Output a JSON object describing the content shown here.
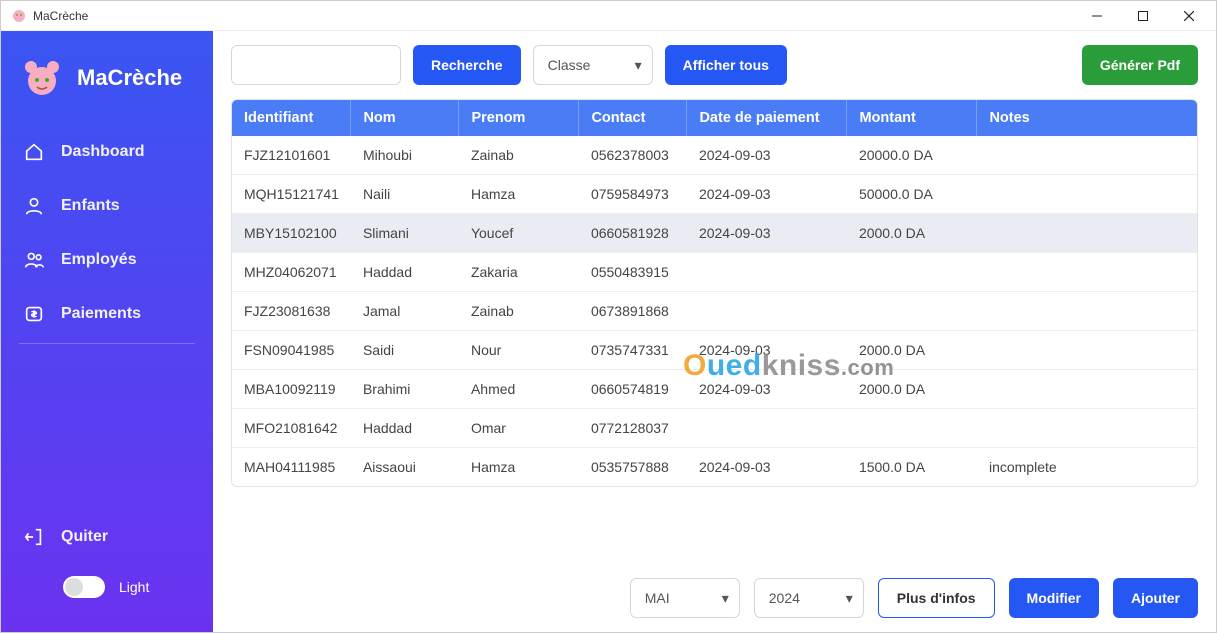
{
  "window": {
    "title": "MaCrèche"
  },
  "brand": {
    "name": "MaCrèche"
  },
  "sidebar": {
    "items": [
      {
        "label": "Dashboard"
      },
      {
        "label": "Enfants"
      },
      {
        "label": "Employés"
      },
      {
        "label": "Paiements"
      }
    ],
    "quit": "Quiter",
    "theme_label": "Light"
  },
  "toolbar": {
    "search_value": "",
    "search_label": "Recherche",
    "filter_selected": "Classe",
    "show_all_label": "Afficher tous",
    "pdf_label": "Générer Pdf"
  },
  "table": {
    "headers": {
      "id": "Identifiant",
      "nom": "Nom",
      "prenom": "Prenom",
      "contact": "Contact",
      "date": "Date de paiement",
      "montant": "Montant",
      "notes": "Notes"
    },
    "rows": [
      {
        "id": "FJZ12101601",
        "nom": "Mihoubi",
        "prenom": "Zainab",
        "contact": "0562378003",
        "date": "2024-09-03",
        "montant": "20000.0 DA",
        "notes": "",
        "selected": false
      },
      {
        "id": "MQH15121741",
        "nom": "Naili",
        "prenom": "Hamza",
        "contact": "0759584973",
        "date": "2024-09-03",
        "montant": "50000.0 DA",
        "notes": "",
        "selected": false
      },
      {
        "id": "MBY15102100",
        "nom": "Slimani",
        "prenom": "Youcef",
        "contact": "0660581928",
        "date": "2024-09-03",
        "montant": "2000.0 DA",
        "notes": "",
        "selected": true
      },
      {
        "id": "MHZ04062071",
        "nom": "Haddad",
        "prenom": "Zakaria",
        "contact": "0550483915",
        "date": "",
        "montant": "",
        "notes": "",
        "selected": false
      },
      {
        "id": "FJZ23081638",
        "nom": "Jamal",
        "prenom": "Zainab",
        "contact": "0673891868",
        "date": "",
        "montant": "",
        "notes": "",
        "selected": false
      },
      {
        "id": "FSN09041985",
        "nom": "Saidi",
        "prenom": "Nour",
        "contact": "0735747331",
        "date": "2024-09-03",
        "montant": "2000.0 DA",
        "notes": "",
        "selected": false
      },
      {
        "id": "MBA10092119",
        "nom": "Brahimi",
        "prenom": "Ahmed",
        "contact": "0660574819",
        "date": "2024-09-03",
        "montant": "2000.0 DA",
        "notes": "",
        "selected": false
      },
      {
        "id": "MFO21081642",
        "nom": "Haddad",
        "prenom": "Omar",
        "contact": "0772128037",
        "date": "",
        "montant": "",
        "notes": "",
        "selected": false
      },
      {
        "id": "MAH04111985",
        "nom": "Aissaoui",
        "prenom": "Hamza",
        "contact": "0535757888",
        "date": "2024-09-03",
        "montant": "1500.0 DA",
        "notes": "incomplete",
        "selected": false
      }
    ]
  },
  "footer": {
    "month_selected": "MAI",
    "year_selected": "2024",
    "more_label": "Plus d'infos",
    "edit_label": "Modifier",
    "add_label": "Ajouter"
  },
  "watermark": {
    "part1": "O",
    "part2": "ued",
    "part3": "kniss",
    "part4": ".com"
  }
}
